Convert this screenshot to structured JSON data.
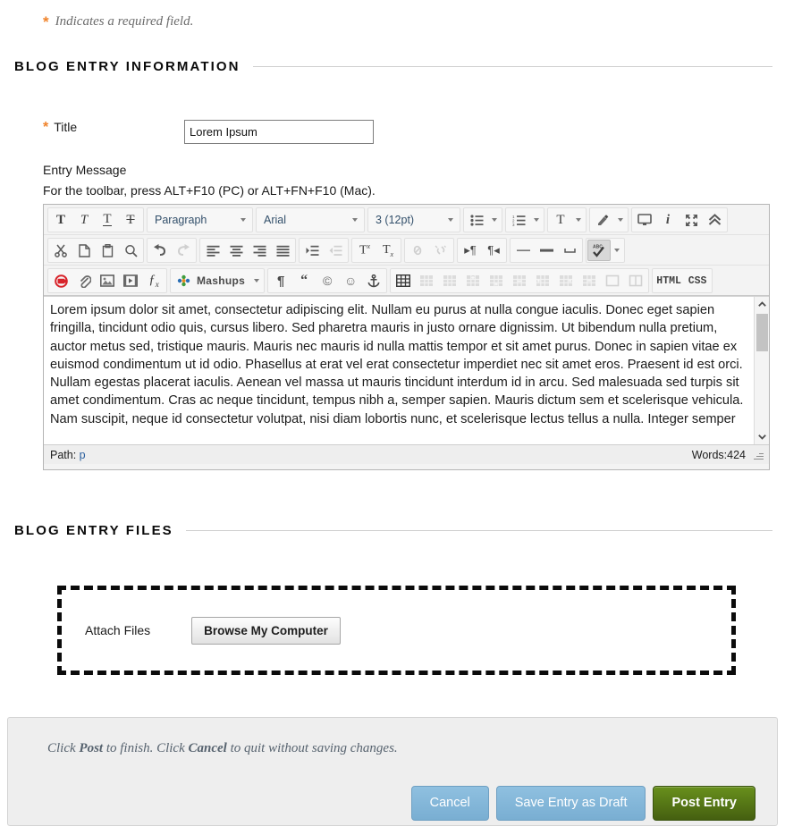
{
  "required_note": {
    "asterisk": "*",
    "text": "Indicates a required field."
  },
  "sections": {
    "info": {
      "heading": "BLOG ENTRY INFORMATION"
    },
    "files": {
      "heading": "BLOG ENTRY FILES"
    }
  },
  "form": {
    "title_field": {
      "asterisk": "*",
      "label": "Title",
      "value": "Lorem Ipsum"
    },
    "entry_message": {
      "label": "Entry Message",
      "hint": "For the toolbar, press ALT+F10 (PC) or ALT+FN+F10 (Mac)."
    }
  },
  "editor": {
    "toolbar_row1": {
      "bold": "Bold",
      "italic": "Italic",
      "underline": "Underline",
      "strikethrough": "Strikethrough",
      "paragraph_select": "Paragraph",
      "font_select": "Arial",
      "size_select": "3 (12pt)",
      "bullet_list": "Unordered List",
      "numbered_list": "Ordered List",
      "text_color": "Text Color",
      "highlight": "Highlight Color",
      "preview": "Preview",
      "info": "Help Info",
      "fullscreen": "Expand",
      "collapse": "Collapse Toolbar"
    },
    "toolbar_row2": {
      "cut": "Cut",
      "copy": "Copy",
      "paste": "Paste",
      "find": "Find and Replace",
      "undo": "Undo",
      "redo": "Redo",
      "align_left": "Align Left",
      "align_center": "Align Center",
      "align_right": "Align Right",
      "align_justify": "Justify",
      "indent": "Indent",
      "outdent": "Outdent",
      "superscript": "Superscript",
      "subscript": "Subscript",
      "link": "Insert Link",
      "unlink": "Remove Link",
      "ltr": "Left to Right",
      "rtl": "Right to Left",
      "hr_thin": "Horizontal Rule",
      "hr_thick": "Thick Rule",
      "nbsp": "Non-breaking Space",
      "spellcheck": "Spell Check"
    },
    "toolbar_row3": {
      "record": "Record from Webcam",
      "attach": "Attach File",
      "image": "Insert Image",
      "video": "Insert Video",
      "math": "Insert Math Formula",
      "mashups": "Mashups",
      "paragraph_mark": "Show Paragraph Marks",
      "quote": "Insert Quote",
      "copyright": "Insert Copyright",
      "emoji": "Insert Emoticon",
      "anchor": "Insert Anchor",
      "table_insert": "Insert Table",
      "table_row_props": "Table Row Properties",
      "table_cell_props": "Table Cell Properties",
      "table_insert_row_before": "Insert Row Before",
      "table_insert_row_after": "Insert Row After",
      "table_delete_row": "Delete Row",
      "table_insert_col_before": "Insert Column Before",
      "table_insert_col_after": "Insert Column After",
      "table_delete_col": "Delete Column",
      "table_split_cell": "Split Cell",
      "table_merge_cells": "Merge Cells",
      "html_button": "HTML",
      "css_button": "CSS"
    },
    "body_text": "Lorem ipsum dolor sit amet, consectetur adipiscing elit. Nullam eu purus at nulla congue iaculis. Donec eget sapien fringilla, tincidunt odio quis, cursus libero. Sed pharetra mauris in justo ornare dignissim. Ut bibendum nulla pretium, auctor metus sed, tristique mauris. Mauris nec mauris id nulla mattis tempor et sit amet purus. Donec in sapien vitae ex euismod condimentum ut id odio. Phasellus at erat vel erat consectetur imperdiet nec sit amet eros. Praesent id est orci. Nullam egestas placerat iaculis. Aenean vel massa ut mauris tincidunt interdum id in arcu. Sed malesuada sed turpis sit amet condimentum. Cras ac neque tincidunt, tempus nibh a, semper sapien. Mauris dictum sem et scelerisque vehicula. Nam suscipit, neque id consectetur volutpat, nisi diam lobortis nunc, et scelerisque lectus tellus a nulla. Integer semper",
    "statusbar": {
      "path_label": "Path:",
      "path_value": "p",
      "words": "Words:424"
    }
  },
  "files": {
    "attach_label": "Attach Files",
    "browse_button": "Browse My Computer"
  },
  "footer": {
    "hint_a": "Click ",
    "hint_b1": "Post",
    "hint_c": " to finish. Click ",
    "hint_b2": "Cancel",
    "hint_d": " to quit without saving changes.",
    "cancel": "Cancel",
    "save_draft": "Save Entry as Draft",
    "post": "Post Entry"
  },
  "colors": {
    "accent_orange": "#f0832b",
    "blue_button": "#82b5d8",
    "green_button": "#4f7314",
    "heading_text": "#0a0a0a",
    "hint_text": "#56626e"
  }
}
